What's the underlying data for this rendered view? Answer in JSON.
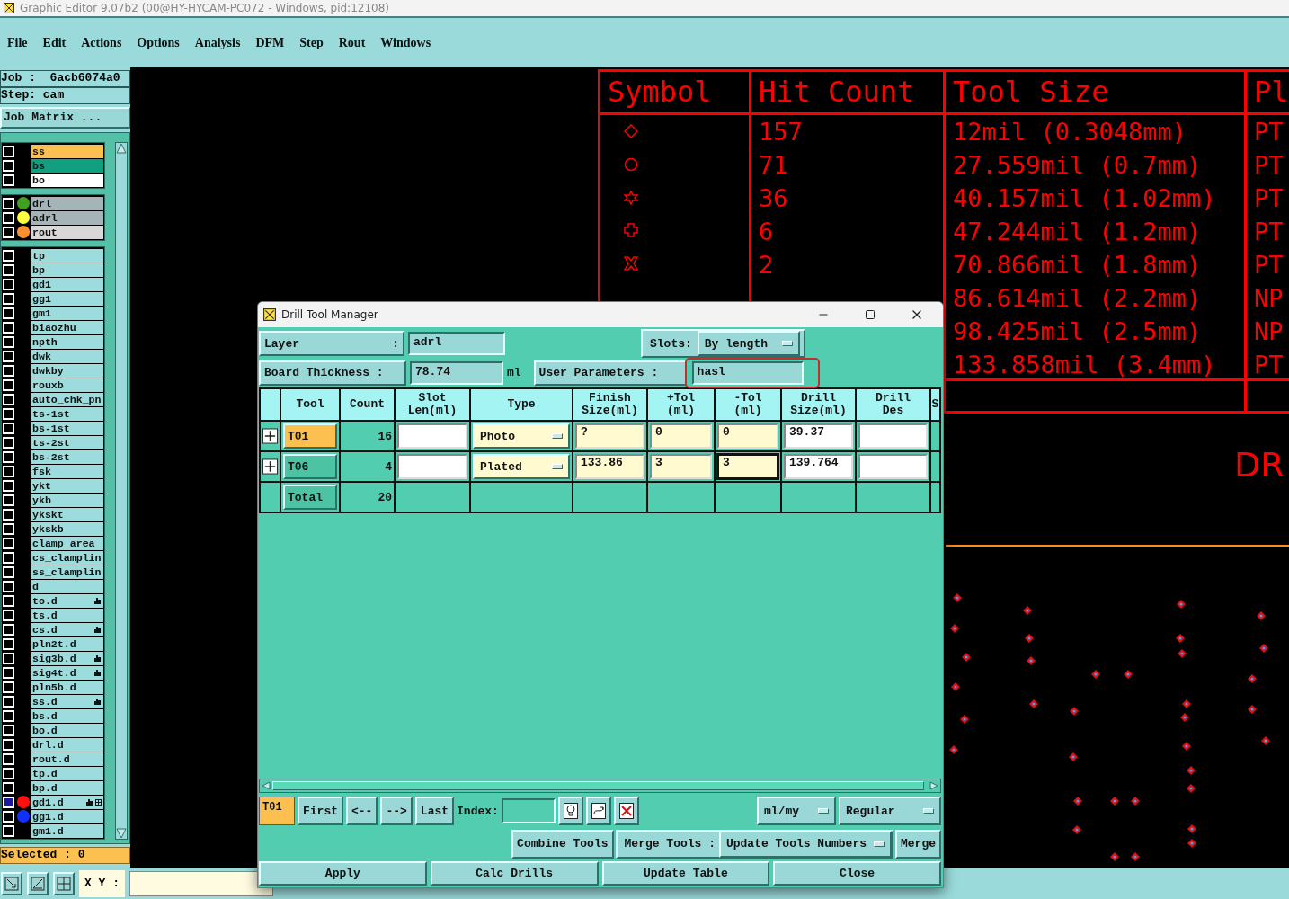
{
  "app_title": "Graphic Editor 9.07b2 (00@HY-HYCAM-PC072 - Windows, pid:12108)",
  "menu": [
    "File",
    "Edit",
    "Actions",
    "Options",
    "Analysis",
    "DFM",
    "Step",
    "Rout",
    "Windows"
  ],
  "job_line": "Job :  6acb6074a0",
  "step_line": "Step: cam",
  "matrix_button": "Job Matrix ...",
  "layer_groups": [
    {
      "rows": [
        {
          "name": "ss",
          "color": "#fcc050",
          "selected": false,
          "hand": false,
          "grid": false
        },
        {
          "name": "bs",
          "color": "#10a080",
          "selected": false,
          "hand": false,
          "grid": false
        },
        {
          "name": "bo",
          "color": "#ffffff",
          "selected": false,
          "hand": false,
          "grid": false
        }
      ]
    },
    {
      "rows": [
        {
          "name": "drl",
          "color": "#a4b4b8",
          "dot": {
            "color": "#40a020"
          },
          "selected": false,
          "hand": false,
          "grid": false
        },
        {
          "name": "adrl",
          "color": "#a4b4b8",
          "dot": {
            "color": "#ffff40"
          },
          "selected": false,
          "hand": false,
          "grid": false
        },
        {
          "name": "rout",
          "color": "#d8d8d8",
          "dot": {
            "color": "#ff9030"
          },
          "selected": false,
          "hand": false,
          "grid": false
        }
      ]
    },
    {
      "rows": [
        {
          "name": "tp",
          "color": "#9cdcdc",
          "selected": false,
          "hand": false,
          "grid": false
        },
        {
          "name": "bp",
          "color": "#9cdcdc",
          "selected": false,
          "hand": false,
          "grid": false
        },
        {
          "name": "gd1",
          "color": "#9cdcdc",
          "selected": false,
          "hand": false,
          "grid": false
        },
        {
          "name": "gg1",
          "color": "#9cdcdc",
          "selected": false,
          "hand": false,
          "grid": false
        },
        {
          "name": "gm1",
          "color": "#9cdcdc",
          "selected": false,
          "hand": false,
          "grid": false
        },
        {
          "name": "biaozhu",
          "color": "#9cdcdc",
          "selected": false,
          "hand": false,
          "grid": false
        },
        {
          "name": "npth",
          "color": "#9cdcdc",
          "selected": false,
          "hand": false,
          "grid": false
        },
        {
          "name": "dwk",
          "color": "#9cdcdc",
          "selected": false,
          "hand": false,
          "grid": false
        },
        {
          "name": "dwkby",
          "color": "#9cdcdc",
          "selected": false,
          "hand": false,
          "grid": false
        },
        {
          "name": "rouxb",
          "color": "#9cdcdc",
          "selected": false,
          "hand": false,
          "grid": false
        },
        {
          "name": "auto_chk_pn",
          "color": "#9cdcdc",
          "selected": false,
          "hand": false,
          "grid": false
        },
        {
          "name": "ts-1st",
          "color": "#9cdcdc",
          "selected": false,
          "hand": false,
          "grid": false
        },
        {
          "name": "bs-1st",
          "color": "#9cdcdc",
          "selected": false,
          "hand": false,
          "grid": false
        },
        {
          "name": "ts-2st",
          "color": "#9cdcdc",
          "selected": false,
          "hand": false,
          "grid": false
        },
        {
          "name": "bs-2st",
          "color": "#9cdcdc",
          "selected": false,
          "hand": false,
          "grid": false
        },
        {
          "name": "fsk",
          "color": "#9cdcdc",
          "selected": false,
          "hand": false,
          "grid": false
        },
        {
          "name": "ykt",
          "color": "#9cdcdc",
          "selected": false,
          "hand": false,
          "grid": false
        },
        {
          "name": "ykb",
          "color": "#9cdcdc",
          "selected": false,
          "hand": false,
          "grid": false
        },
        {
          "name": "ykskt",
          "color": "#9cdcdc",
          "selected": false,
          "hand": false,
          "grid": false
        },
        {
          "name": "ykskb",
          "color": "#9cdcdc",
          "selected": false,
          "hand": false,
          "grid": false
        },
        {
          "name": "clamp_area",
          "color": "#9cdcdc",
          "selected": false,
          "hand": false,
          "grid": false
        },
        {
          "name": "cs_clamplin",
          "color": "#9cdcdc",
          "selected": false,
          "hand": false,
          "grid": false
        },
        {
          "name": "ss_clamplin",
          "color": "#9cdcdc",
          "selected": false,
          "hand": false,
          "grid": false
        },
        {
          "name": "d",
          "color": "#9cdcdc",
          "selected": false,
          "hand": false,
          "grid": false
        },
        {
          "name": "to.d",
          "color": "#9cdcdc",
          "selected": false,
          "hand": true,
          "grid": false
        },
        {
          "name": "ts.d",
          "color": "#9cdcdc",
          "selected": false,
          "hand": false,
          "grid": false
        },
        {
          "name": "cs.d",
          "color": "#9cdcdc",
          "selected": false,
          "hand": true,
          "grid": false
        },
        {
          "name": "pln2t.d",
          "color": "#9cdcdc",
          "selected": false,
          "hand": false,
          "grid": false
        },
        {
          "name": "sig3b.d",
          "color": "#9cdcdc",
          "selected": false,
          "hand": true,
          "grid": false
        },
        {
          "name": "sig4t.d",
          "color": "#9cdcdc",
          "selected": false,
          "hand": true,
          "grid": false
        },
        {
          "name": "pln5b.d",
          "color": "#9cdcdc",
          "selected": false,
          "hand": false,
          "grid": false
        },
        {
          "name": "ss.d",
          "color": "#9cdcdc",
          "selected": false,
          "hand": true,
          "grid": false
        },
        {
          "name": "bs.d",
          "color": "#9cdcdc",
          "selected": false,
          "hand": false,
          "grid": false
        },
        {
          "name": "bo.d",
          "color": "#9cdcdc",
          "selected": false,
          "hand": false,
          "grid": false
        },
        {
          "name": "drl.d",
          "color": "#9cdcdc",
          "selected": false,
          "hand": false,
          "grid": false
        },
        {
          "name": "rout.d",
          "color": "#9cdcdc",
          "selected": false,
          "hand": false,
          "grid": false
        },
        {
          "name": "tp.d",
          "color": "#9cdcdc",
          "selected": false,
          "hand": false,
          "grid": false
        },
        {
          "name": "bp.d",
          "color": "#9cdcdc",
          "selected": false,
          "hand": false,
          "grid": false
        },
        {
          "name": "gd1.d",
          "color": "#9cdcdc",
          "dot": {
            "color": "#ff1010"
          },
          "selected": true,
          "hand": true,
          "grid": true
        },
        {
          "name": "gg1.d",
          "color": "#9cdcdc",
          "dot": {
            "color": "#1030ff"
          },
          "selected": false,
          "hand": false,
          "grid": false
        },
        {
          "name": "gm1.d",
          "color": "#9cdcdc",
          "selected": false,
          "hand": false,
          "grid": false
        }
      ]
    }
  ],
  "selected_count": "Selected : 0",
  "coord_label": "X Y :",
  "canvas": {
    "columns": [
      "Symbol",
      "Hit Count",
      "Tool Size",
      "Pl"
    ],
    "rows": [
      {
        "kind": "diamond",
        "hits": "157",
        "size": "12mil (0.3048mm)",
        "plating": "PT"
      },
      {
        "kind": "circle",
        "hits": "71",
        "size": "27.559mil (0.7mm)",
        "plating": "PT"
      },
      {
        "kind": "star",
        "hits": "36",
        "size": "40.157mil (1.02mm)",
        "plating": "PT"
      },
      {
        "kind": "cross",
        "hits": "6",
        "size": "47.244mil (1.2mm)",
        "plating": "PT"
      },
      {
        "kind": "x",
        "hits": "2",
        "size": "70.866mil (1.8mm)",
        "plating": "PT"
      },
      {
        "kind": "blank",
        "size": "86.614mil (2.2mm)",
        "plating": "NP"
      },
      {
        "kind": "blank",
        "size": "98.425mil (2.5mm)",
        "plating": "NP"
      },
      {
        "kind": "blank",
        "size": "133.858mil (3.4mm)",
        "plating": "PT"
      }
    ],
    "label": "DR"
  },
  "dialog": {
    "title": "Drill Tool Manager",
    "layer_label": "Layer",
    "layer_separator": ":",
    "layer_value": "adrl",
    "slots_label": "Slots:",
    "slots_value": "By length",
    "thickness_label": "Board Thickness :",
    "thickness_value": "78.74",
    "thickness_unit": "ml",
    "user_params_label": "User Parameters :",
    "user_params_value": "hasl",
    "user_params_highlighted": true,
    "columns": [
      "Tool",
      "Count",
      "Slot\nLen(ml)",
      "Type",
      "Finish\nSize(ml)",
      "+Tol\n(ml)",
      "-Tol\n(ml)",
      "Drill\nSize(ml)",
      "Drill\nDes",
      "S"
    ],
    "rows": [
      {
        "tool": "T01",
        "selected": true,
        "count": "16",
        "fields": [
          {
            "kind": "text",
            "required": false,
            "focused": false
          },
          {
            "kind": "select",
            "value": "Photo"
          },
          {
            "kind": "text",
            "required": true,
            "focused": false,
            "value": "?"
          },
          {
            "kind": "text",
            "required": true,
            "focused": false,
            "value": "0"
          },
          {
            "kind": "text",
            "required": true,
            "focused": false,
            "value": "0"
          },
          {
            "kind": "text",
            "required": false,
            "focused": false,
            "value": "39.37"
          },
          {
            "kind": "text",
            "required": false,
            "focused": false
          }
        ]
      },
      {
        "tool": "T06",
        "selected": false,
        "count": "4",
        "fields": [
          {
            "kind": "text",
            "required": false,
            "focused": false
          },
          {
            "kind": "select",
            "value": "Plated"
          },
          {
            "kind": "text",
            "required": true,
            "focused": false,
            "value": "133.86"
          },
          {
            "kind": "text",
            "required": true,
            "focused": false,
            "value": "3"
          },
          {
            "kind": "text",
            "required": true,
            "focused": true,
            "value": "3"
          },
          {
            "kind": "text",
            "required": false,
            "focused": false,
            "value": "139.764"
          },
          {
            "kind": "text",
            "required": false,
            "focused": false
          }
        ]
      }
    ],
    "total_label": "Total",
    "total_count": "20",
    "current_tool": "T01",
    "nav_buttons": [
      "First",
      "<--",
      "-->",
      "Last"
    ],
    "index_label": "Index:",
    "units": "ml/my",
    "mode": "Regular",
    "combine_button": "Combine Tools",
    "merge_label": "Merge Tools :",
    "merge_option": "Update Tools Numbers",
    "merge_button": "Merge",
    "actions": [
      "Apply",
      "Calc Drills",
      "Update Table",
      "Close"
    ]
  }
}
